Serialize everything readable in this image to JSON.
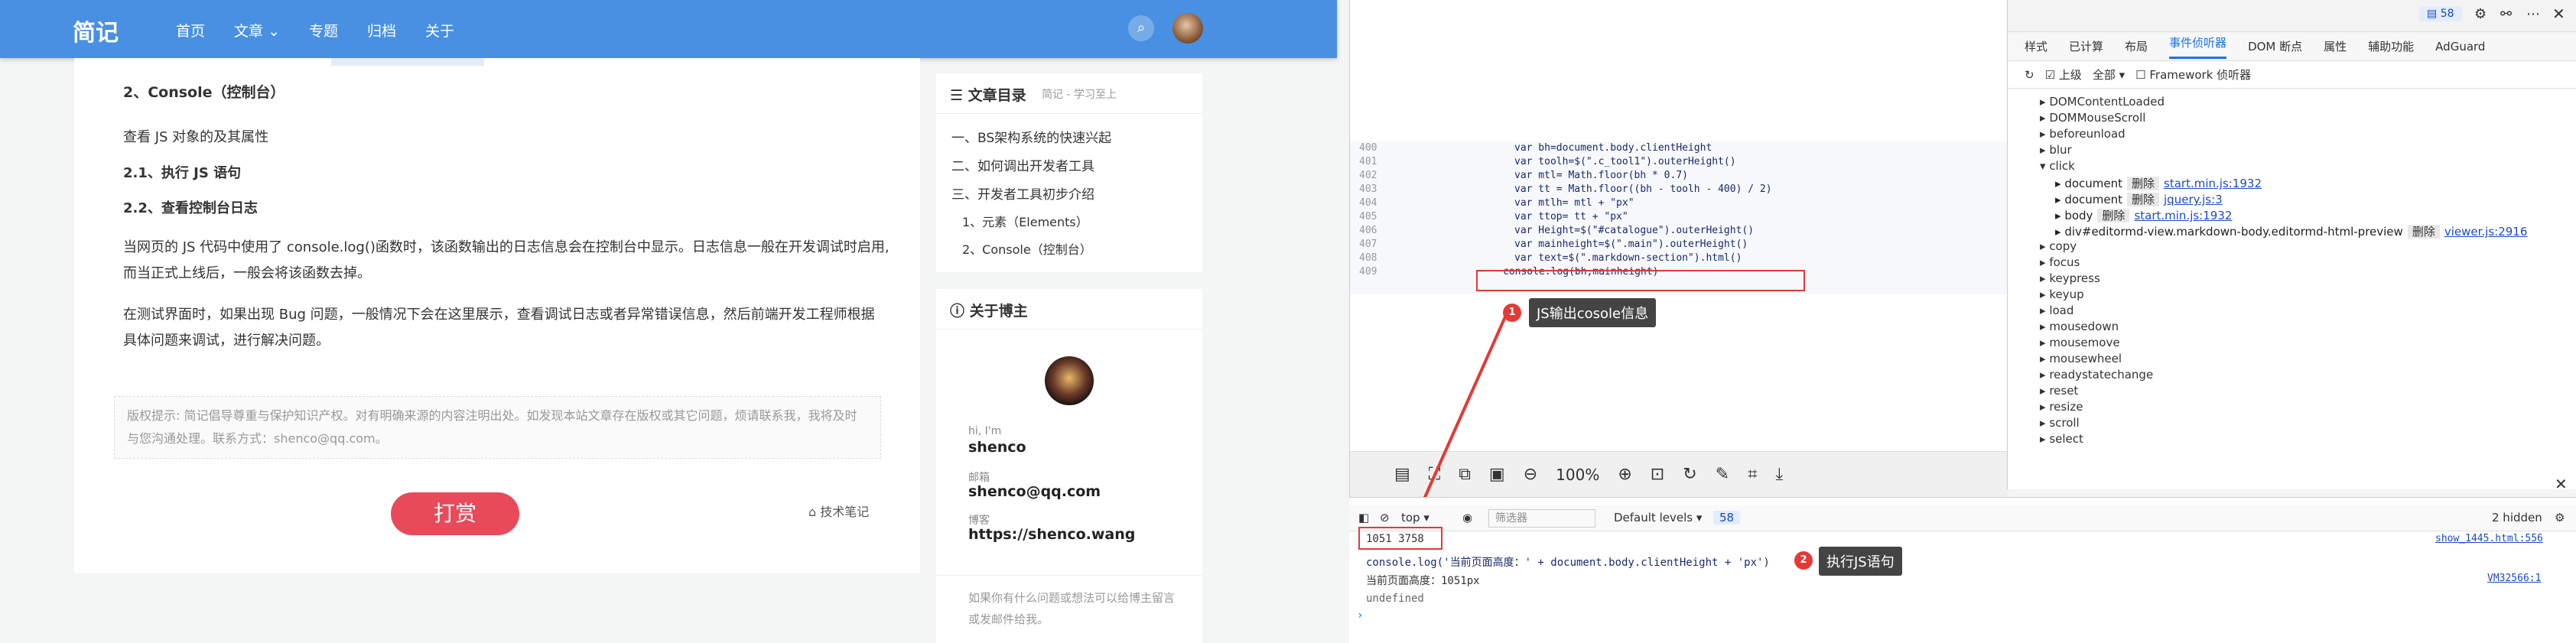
{
  "blog": {
    "logo": "简记",
    "nav": [
      "首页",
      "文章",
      "专题",
      "归档",
      "关于"
    ],
    "nav_arrow": "chevron-down-icon",
    "search_icon": "search-icon",
    "article": {
      "h2": "2、Console（控制台）",
      "p1": "查看 JS 对象的及其属性",
      "h3a": "2.1、执行 JS 语句",
      "h3b": "2.2、查看控制台日志",
      "p2a": "当网页的 JS 代码中使用了 console.log()函数时，该函数输出的日志信息会在控制台中显示。日志信息一般在开发调试时启用,",
      "p2b": "而当正式上线后，一般会将该函数去掉。",
      "p3a": "在测试界面时，如果出现 Bug 问题，一般情况下会在这里展示，查看调试日志或者异常错误信息，然后前端开发工程师根据",
      "p3b": "具体问题来调试，进行解决问题。",
      "notice_a": "版权提示: 简记倡导尊重与保护知识产权。对有明确来源的内容注明出处。如发现本站文章存在版权或其它问题，烦请联系我，我将及时",
      "notice_b": "与您沟通处理。联系方式：shenco@qq.com。",
      "reward": "打赏",
      "category": "技术笔记"
    },
    "toc": {
      "title": "文章目录",
      "sub": "简记 - 学习至上",
      "items": [
        "一、BS架构系统的快速兴起",
        "二、如何调出开发者工具",
        "三、开发者工具初步介绍",
        "1、元素（Elements）",
        "2、Console（控制台）"
      ]
    },
    "about": {
      "title": "关于博主",
      "hi": "hi, I'm",
      "name": "shenco",
      "mail_label": "邮箱",
      "mail": "shenco@qq.com",
      "blog_label": "博客",
      "blog": "https://shenco.wang",
      "foot": "如果你有什么问题或想法可以给博主留言或发邮件给我。"
    }
  },
  "editor": {
    "lines": [
      {
        "n": "400",
        "t": "var bh=document.body.clientHeight"
      },
      {
        "n": "401",
        "t": "var toolh=$(\".c_tool1\").outerHeight()"
      },
      {
        "n": "402",
        "t": "var mtl= Math.floor(bh * 0.7)"
      },
      {
        "n": "403",
        "t": "var tt = Math.floor((bh - toolh - 400) / 2)"
      },
      {
        "n": "404",
        "t": "var mtlh= mtl + \"px\""
      },
      {
        "n": "405",
        "t": "var ttop= tt + \"px\""
      },
      {
        "n": "406",
        "t": "var Height=$(\"#catalogue\").outerHeight()"
      },
      {
        "n": "407",
        "t": "var mainheight=$(\".main\").outerHeight()"
      },
      {
        "n": "408",
        "t": "var text=$(\".markdown-section\").html()"
      },
      {
        "n": "409",
        "t": "console.log(bh,mainheight)"
      }
    ],
    "tip1": "JS输出cosole信息",
    "badge1": "1",
    "zoom": "100%"
  },
  "devtools": {
    "counter": "58",
    "tabs": [
      "样式",
      "已计算",
      "布局",
      "事件侦听器",
      "DOM 断点",
      "属性",
      "辅助功能",
      "AdGuard"
    ],
    "filter_up": "上级",
    "filter_all": "全部",
    "framework": "Framework 侦听器",
    "events": [
      "DOMContentLoaded",
      "DOMMouseScroll",
      "beforeunload",
      "blur",
      "click"
    ],
    "click_items": [
      {
        "el": "document",
        "src": "start.min.js:1932"
      },
      {
        "el": "document",
        "src": "jquery.js:3"
      },
      {
        "el": "body",
        "src": "start.min.js:1932"
      },
      {
        "el": "div#editormd-view.markdown-body.editormd-html-preview",
        "src": "viewer.js:2916"
      }
    ],
    "delete": "删除",
    "events2": [
      "copy",
      "focus",
      "keypress",
      "keyup",
      "load",
      "mousedown",
      "mousemove",
      "mousewheel",
      "readystatechange",
      "reset",
      "resize",
      "scroll",
      "select"
    ]
  },
  "console": {
    "top": "top",
    "filter": "筛选器",
    "levels": "Default levels",
    "count": "58",
    "hidden": "2 hidden",
    "out1": "1051 3758",
    "src1": "show_1445.html:556",
    "cmd": "console.log('当前页面高度：' + document.body.clientHeight + 'px')",
    "res": "当前页面高度：1051px",
    "src2": "VM32566:1",
    "undef": "undefined",
    "tip2": "执行JS语句",
    "badge2": "2"
  }
}
